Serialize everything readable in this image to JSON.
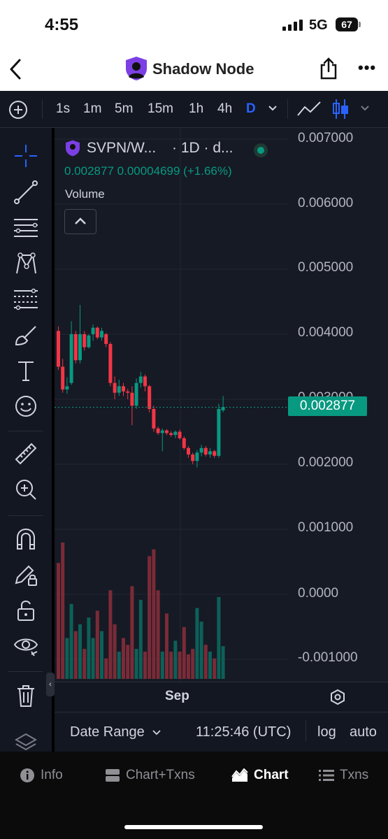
{
  "status": {
    "time": "4:55",
    "network": "5G",
    "battery": "67"
  },
  "nav": {
    "title": "Shadow Node",
    "logo_icon": "shield-avatar-icon"
  },
  "toolbar": {
    "timeframes": [
      "1s",
      "1m",
      "5m",
      "15m",
      "1h",
      "4h",
      "D"
    ],
    "active_timeframe": "D"
  },
  "chart": {
    "symbol": "SVPN/W...",
    "symbol_suffix": "· 1D · d...",
    "last_price": "0.002877",
    "change": "0.00004699 (+1.66%)",
    "volume_label": "Volume",
    "price_tag": "0.002877",
    "x_label": "Sep",
    "y_axis_labels": [
      "0.007000",
      "0.006000",
      "0.005000",
      "0.004000",
      "0.003000",
      "0.002000",
      "0.001000",
      "0.0000",
      "-0.001000"
    ],
    "colors": {
      "up": "#089981",
      "down": "#f23645",
      "background": "#161a25"
    }
  },
  "chart_data": {
    "type": "candlestick",
    "ylim": [
      -0.0013,
      0.0072
    ],
    "candles": [
      {
        "o": 0.00405,
        "h": 0.00412,
        "l": 0.00345,
        "c": 0.0035
      },
      {
        "o": 0.0035,
        "h": 0.00362,
        "l": 0.0031,
        "c": 0.00315
      },
      {
        "o": 0.00315,
        "h": 0.00334,
        "l": 0.00308,
        "c": 0.0032
      },
      {
        "o": 0.00325,
        "h": 0.0042,
        "l": 0.00322,
        "c": 0.004
      },
      {
        "o": 0.004,
        "h": 0.00405,
        "l": 0.00355,
        "c": 0.0036
      },
      {
        "o": 0.0036,
        "h": 0.00445,
        "l": 0.00355,
        "c": 0.004
      },
      {
        "o": 0.004,
        "h": 0.00405,
        "l": 0.00375,
        "c": 0.0038
      },
      {
        "o": 0.0038,
        "h": 0.004,
        "l": 0.00378,
        "c": 0.00398
      },
      {
        "o": 0.004,
        "h": 0.00415,
        "l": 0.0039,
        "c": 0.0041
      },
      {
        "o": 0.0041,
        "h": 0.00412,
        "l": 0.00392,
        "c": 0.00395
      },
      {
        "o": 0.00395,
        "h": 0.0041,
        "l": 0.0039,
        "c": 0.00405
      },
      {
        "o": 0.004,
        "h": 0.00402,
        "l": 0.0038,
        "c": 0.00385
      },
      {
        "o": 0.00385,
        "h": 0.00388,
        "l": 0.0032,
        "c": 0.00325
      },
      {
        "o": 0.00325,
        "h": 0.00335,
        "l": 0.003,
        "c": 0.0031
      },
      {
        "o": 0.0031,
        "h": 0.0033,
        "l": 0.00305,
        "c": 0.0032
      },
      {
        "o": 0.0032,
        "h": 0.00325,
        "l": 0.00305,
        "c": 0.00312
      },
      {
        "o": 0.00312,
        "h": 0.00316,
        "l": 0.003,
        "c": 0.0031
      },
      {
        "o": 0.0031,
        "h": 0.0032,
        "l": 0.0026,
        "c": 0.0029
      },
      {
        "o": 0.0029,
        "h": 0.00332,
        "l": 0.00285,
        "c": 0.00325
      },
      {
        "o": 0.00325,
        "h": 0.00342,
        "l": 0.00318,
        "c": 0.00335
      },
      {
        "o": 0.00335,
        "h": 0.00338,
        "l": 0.00312,
        "c": 0.0032
      },
      {
        "o": 0.0032,
        "h": 0.00322,
        "l": 0.0028,
        "c": 0.00285
      },
      {
        "o": 0.00285,
        "h": 0.0029,
        "l": 0.0025,
        "c": 0.00255
      },
      {
        "o": 0.00255,
        "h": 0.00258,
        "l": 0.00245,
        "c": 0.00248
      },
      {
        "o": 0.00248,
        "h": 0.00255,
        "l": 0.0022,
        "c": 0.00252
      },
      {
        "o": 0.00252,
        "h": 0.00254,
        "l": 0.00245,
        "c": 0.00248
      },
      {
        "o": 0.00248,
        "h": 0.00251,
        "l": 0.00242,
        "c": 0.00245
      },
      {
        "o": 0.00245,
        "h": 0.00252,
        "l": 0.0024,
        "c": 0.0025
      },
      {
        "o": 0.0025,
        "h": 0.00253,
        "l": 0.00238,
        "c": 0.0024
      },
      {
        "o": 0.0024,
        "h": 0.00243,
        "l": 0.00222,
        "c": 0.00225
      },
      {
        "o": 0.00225,
        "h": 0.00228,
        "l": 0.0021,
        "c": 0.00215
      },
      {
        "o": 0.00215,
        "h": 0.00218,
        "l": 0.002,
        "c": 0.00205
      },
      {
        "o": 0.00205,
        "h": 0.00222,
        "l": 0.00195,
        "c": 0.00218
      },
      {
        "o": 0.00218,
        "h": 0.0023,
        "l": 0.00212,
        "c": 0.00225
      },
      {
        "o": 0.00225,
        "h": 0.00228,
        "l": 0.00212,
        "c": 0.00215
      },
      {
        "o": 0.00215,
        "h": 0.00225,
        "l": 0.0021,
        "c": 0.0022
      },
      {
        "o": 0.0022,
        "h": 0.00222,
        "l": 0.0021,
        "c": 0.00213
      },
      {
        "o": 0.00213,
        "h": 0.00293,
        "l": 0.0021,
        "c": 0.00285
      },
      {
        "o": 0.00283,
        "h": 0.00305,
        "l": 0.0028,
        "c": 0.00288
      }
    ],
    "volume_ratio": [
      0.85,
      1.0,
      0.3,
      0.55,
      0.35,
      0.4,
      0.22,
      0.45,
      0.3,
      0.5,
      0.35,
      0.15,
      0.65,
      0.4,
      0.2,
      0.3,
      0.25,
      0.68,
      0.22,
      0.58,
      0.2,
      0.9,
      0.95,
      0.65,
      0.2,
      0.48,
      0.2,
      0.28,
      0.2,
      0.38,
      0.18,
      0.22,
      0.52,
      0.42,
      0.25,
      0.2,
      0.15,
      0.6,
      0.24
    ]
  },
  "bottom": {
    "date_range": "Date Range",
    "clock": "11:25:46 (UTC)",
    "log": "log",
    "auto": "auto"
  },
  "tabs": [
    {
      "label": "Info",
      "icon": "info-icon"
    },
    {
      "label": "Chart+Txns",
      "icon": "split-panel-icon"
    },
    {
      "label": "Chart",
      "icon": "area-chart-icon"
    },
    {
      "label": "Txns",
      "icon": "list-icon"
    }
  ],
  "active_tab": "Chart"
}
